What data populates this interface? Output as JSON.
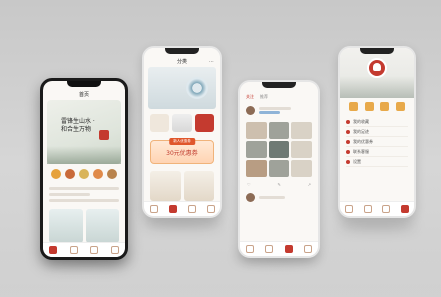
{
  "phone1": {
    "title": "首页",
    "hero_text": "雷锋生山水 · 和合生万物",
    "tabs": [
      "",
      "",
      "",
      ""
    ]
  },
  "phone2": {
    "title": "分类",
    "coupon_tag": "新人优惠券",
    "coupon_amount": "30元优惠券"
  },
  "phone3": {
    "tab_active": "关注",
    "tab_other": "推荐"
  },
  "phone4": {
    "menu": [
      "我的收藏",
      "我的足迹",
      "我的优惠券",
      "联系客服",
      "设置"
    ]
  },
  "colors": {
    "accent": "#c43a2f",
    "gold": "#e6a23c",
    "background": "#d0d0d0"
  }
}
